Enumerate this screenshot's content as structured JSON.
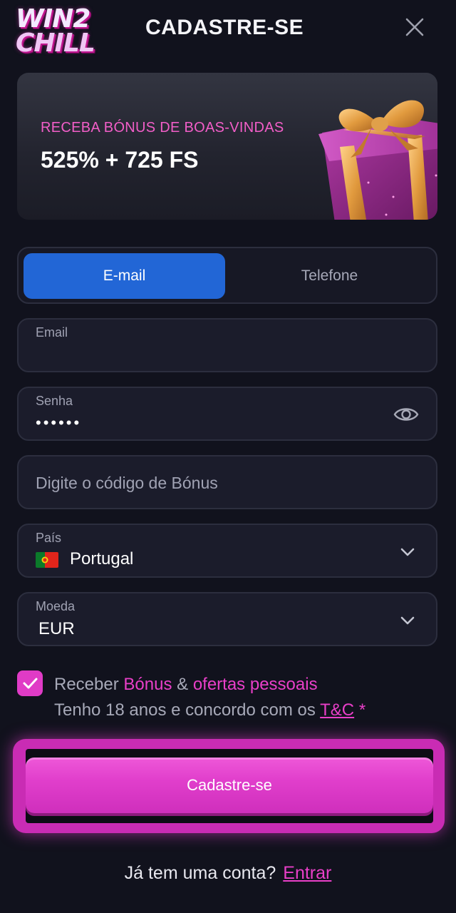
{
  "header": {
    "logo_line1": "WIN2",
    "logo_line2": "CHILL",
    "title": "CADASTRE-SE"
  },
  "banner": {
    "subtitle": "RECEBA BÓNUS DE BOAS-VINDAS",
    "offer": "525% + 725 FS"
  },
  "tabs": {
    "email_label": "E-mail",
    "phone_label": "Telefone",
    "active": "E-mail"
  },
  "form": {
    "email": {
      "label": "Email",
      "value": ""
    },
    "password": {
      "label": "Senha",
      "value": "••••••"
    },
    "bonus_code": {
      "placeholder": "Digite o código de Bónus"
    },
    "country": {
      "label": "País",
      "value": "Portugal"
    },
    "currency": {
      "label": "Moeda",
      "value": "EUR"
    }
  },
  "consent": {
    "checked": true,
    "receive": "Receber",
    "bonus_link": "Bónus",
    "amp": "&",
    "offers_link": "ofertas pessoais",
    "age_text": "Tenho 18 anos e concordo com os",
    "tc_link": "T&C",
    "required_mark": "*"
  },
  "submit_label": "Cadastre-se",
  "footer": {
    "question": "Já tem uma conta?",
    "login_link": "Entrar"
  },
  "colors": {
    "background": "#11121d",
    "accent_pink": "#e93fc8",
    "tab_active_blue": "#2266d6"
  }
}
